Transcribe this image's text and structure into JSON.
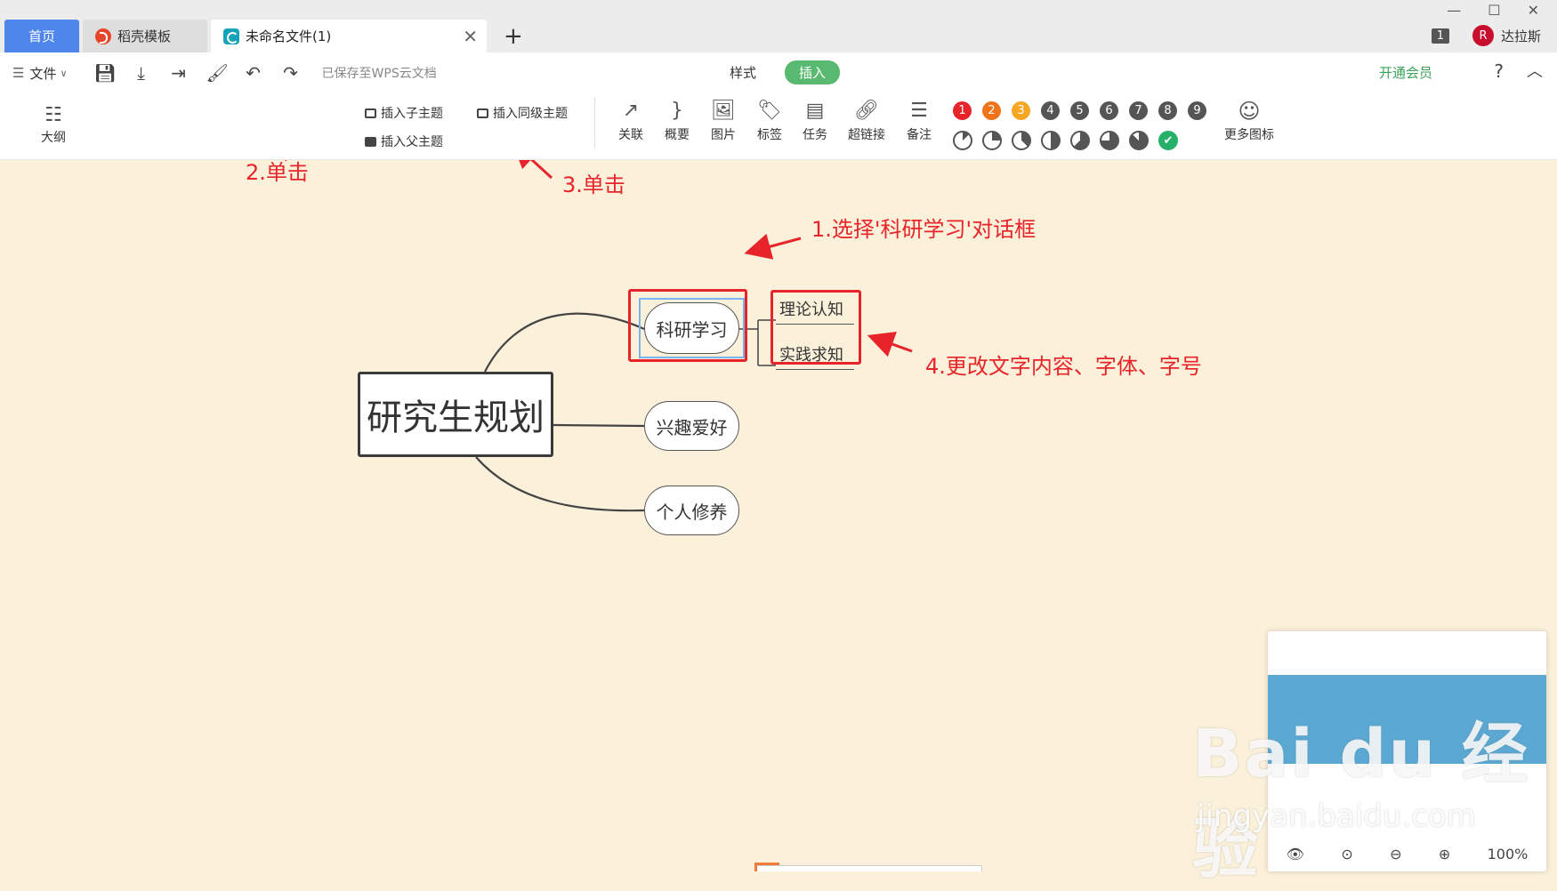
{
  "tabs": {
    "home": "首页",
    "template": "稻壳模板",
    "file": "未命名文件(1)",
    "close": "✕",
    "add": "+"
  },
  "window": {
    "min": "—",
    "max": "☐",
    "close": "✕"
  },
  "user": {
    "count": "1",
    "avatar": "R",
    "name": "达拉斯"
  },
  "toolbar": {
    "file_menu": "文件",
    "saved": "已保存至WPS云文档",
    "mode_style": "样式",
    "mode_insert": "插入",
    "vip": "开通会员",
    "help": "?",
    "collapse": "︿",
    "outline": "大纲",
    "insert_child": "插入子主题",
    "insert_sibling": "插入同级主题",
    "insert_parent": "插入父主题",
    "tools": [
      "关联",
      "概要",
      "图片",
      "标签",
      "任务",
      "超链接",
      "备注"
    ],
    "more_icons": "更多图标",
    "number_badges": [
      "1",
      "2",
      "3",
      "4",
      "5",
      "6",
      "7",
      "8",
      "9"
    ]
  },
  "colors": {
    "canvas_bg": "#fbf1da",
    "annotation_red": "#e8242b",
    "tab_active_blue": "#4f86ec",
    "insert_green": "#5ab970",
    "badge_1": "#e8242b",
    "badge_2": "#f0731a",
    "badge_3": "#f5a623",
    "badge_other": "#555555"
  },
  "mindmap": {
    "root": "研究生规划",
    "branch_study": "科研学习",
    "branch_hobby": "兴趣爱好",
    "branch_self": "个人修养",
    "sub_theory": "理论认知",
    "sub_practice": "实践求知"
  },
  "annotations": {
    "step1": "1.选择'科研学习'对话框",
    "step2": "2.单击",
    "step3": "3.单击",
    "step4": "4.更改文字内容、字体、字号"
  },
  "minimap": {
    "zoom": "100%"
  },
  "watermark": {
    "logo": "Bai du 经验",
    "url": "jingyan.baidu.com"
  }
}
